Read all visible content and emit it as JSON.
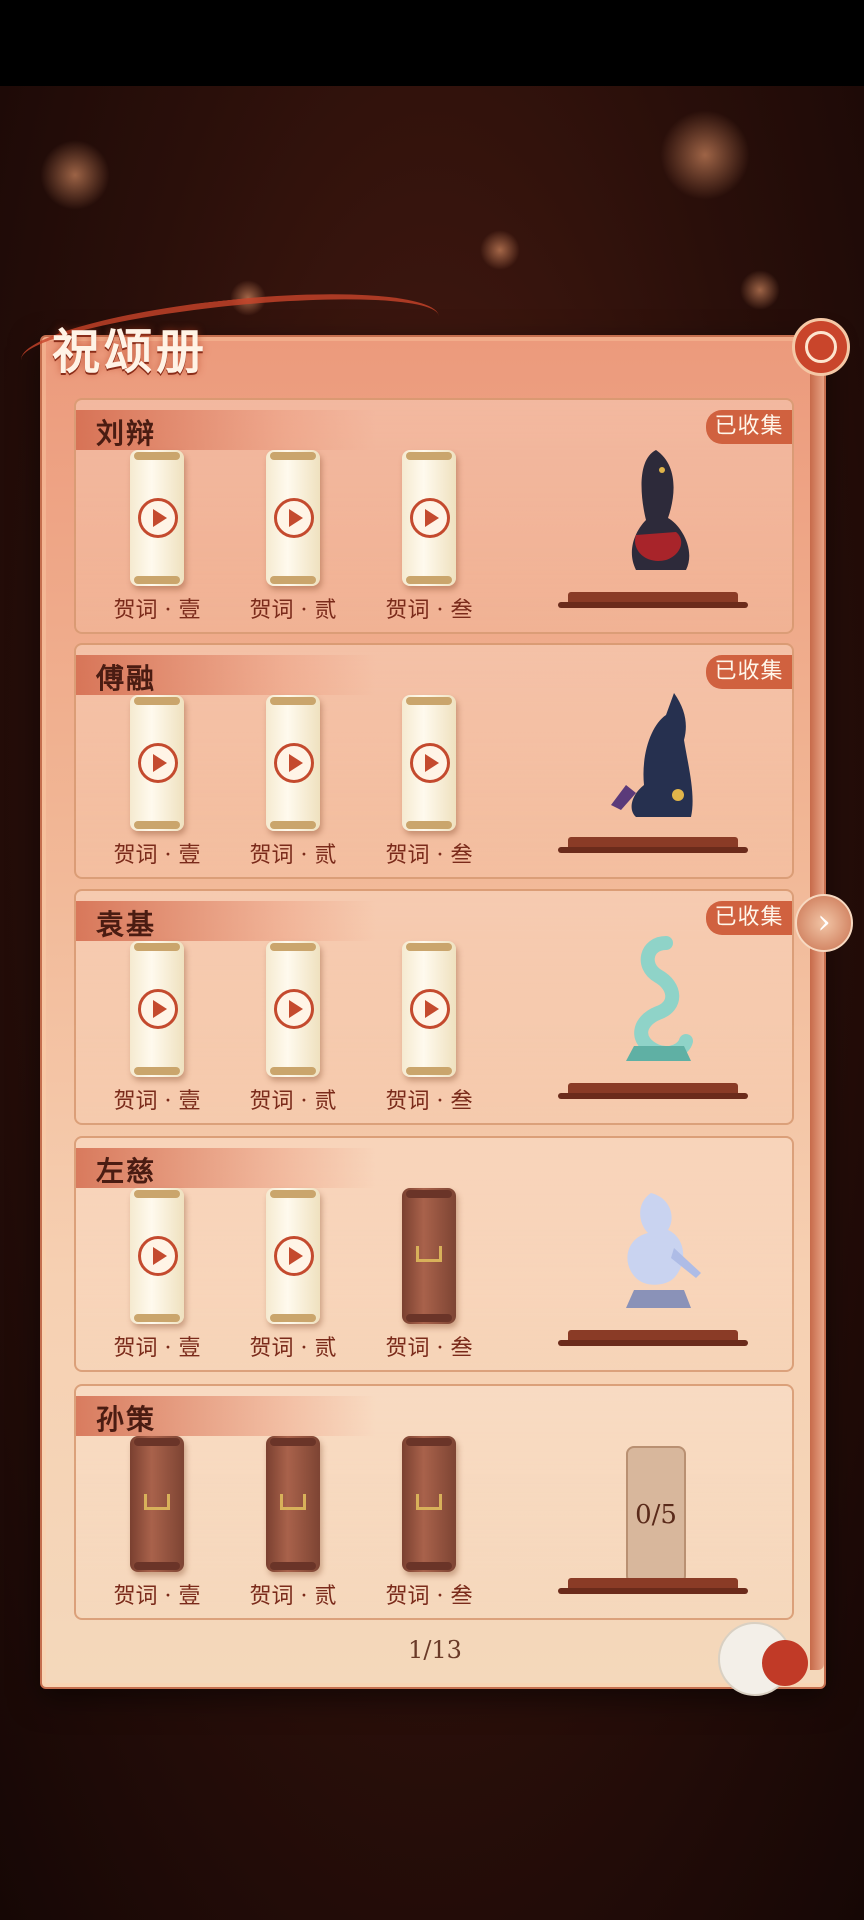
{
  "title": "祝颂册",
  "page_indicator": "1/13",
  "collected_label": "已收集",
  "characters": [
    {
      "name": "刘辩",
      "collected": true,
      "scrolls": [
        {
          "label": "贺词 · 壹",
          "unlocked": true
        },
        {
          "label": "贺词 · 贰",
          "unlocked": true
        },
        {
          "label": "贺词 · 叁",
          "unlocked": true
        }
      ],
      "statue": "cat-statue-icon",
      "statue_color": "#2d2a3a"
    },
    {
      "name": "傅融",
      "collected": true,
      "scrolls": [
        {
          "label": "贺词 · 壹",
          "unlocked": true
        },
        {
          "label": "贺词 · 贰",
          "unlocked": true
        },
        {
          "label": "贺词 · 叁",
          "unlocked": true
        }
      ],
      "statue": "wolf-statue-icon",
      "statue_color": "#26304f"
    },
    {
      "name": "袁基",
      "collected": true,
      "scrolls": [
        {
          "label": "贺词 · 壹",
          "unlocked": true
        },
        {
          "label": "贺词 · 贰",
          "unlocked": true
        },
        {
          "label": "贺词 · 叁",
          "unlocked": true
        }
      ],
      "statue": "snake-statue-icon",
      "statue_color": "#8fd3c8"
    },
    {
      "name": "左慈",
      "collected": false,
      "scrolls": [
        {
          "label": "贺词 · 壹",
          "unlocked": true
        },
        {
          "label": "贺词 · 贰",
          "unlocked": true
        },
        {
          "label": "贺词 · 叁",
          "unlocked": false
        }
      ],
      "statue": "phoenix-statue-icon",
      "statue_color": "#c9d3f0"
    },
    {
      "name": "孙策",
      "collected": false,
      "scrolls": [
        {
          "label": "贺词 · 壹",
          "unlocked": false
        },
        {
          "label": "贺词 · 贰",
          "unlocked": false
        },
        {
          "label": "贺词 · 叁",
          "unlocked": false
        }
      ],
      "progress": "0/5"
    }
  ]
}
